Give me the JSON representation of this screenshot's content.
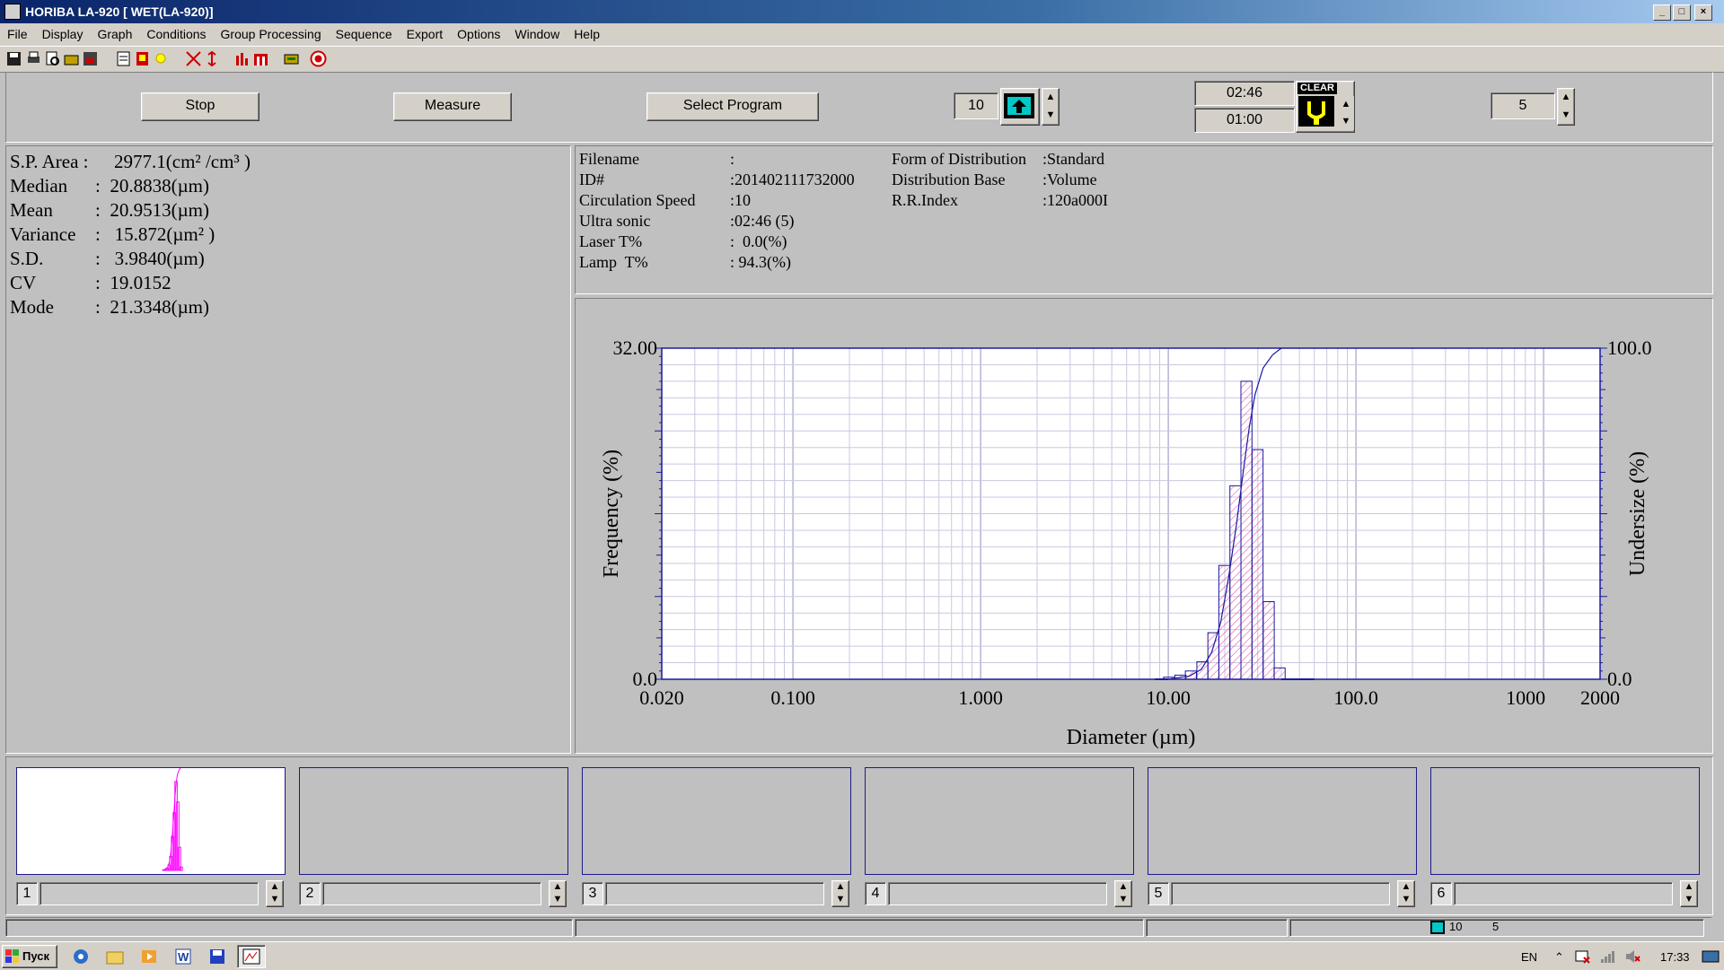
{
  "window": {
    "title": "HORIBA LA-920 [ WET(LA-920)]"
  },
  "menu": [
    "File",
    "Display",
    "Graph",
    "Conditions",
    "Group Processing",
    "Sequence",
    "Export",
    "Options",
    "Window",
    "Help"
  ],
  "controls": {
    "stop_label": "Stop",
    "measure_label": "Measure",
    "select_program_label": "Select Program",
    "circulation_value": "10",
    "time1": "02:46",
    "time2": "01:00",
    "clear_label": "CLEAR",
    "agitation_value": "5"
  },
  "stats": [
    {
      "label": "S.P. Area :",
      "value": "2977.1(cm² /cm³ )"
    },
    {
      "label": "Median",
      "value": ":  20.8838(µm)"
    },
    {
      "label": "Mean",
      "value": ":  20.9513(µm)"
    },
    {
      "label": "Variance",
      "value": ":   15.872(µm² )"
    },
    {
      "label": "S.D.",
      "value": ":   3.9840(µm)"
    },
    {
      "label": "CV",
      "value": ":  19.0152"
    },
    {
      "label": "Mode",
      "value": ":  21.3348(µm)"
    }
  ],
  "info_left": [
    {
      "label": "Filename",
      "value": ":"
    },
    {
      "label": "ID#",
      "value": ":201402111732000"
    },
    {
      "label": "Circulation Speed",
      "value": ":10"
    },
    {
      "label": "Ultra sonic",
      "value": ":02:46 (5)"
    },
    {
      "label": "Laser T%",
      "value": ":  0.0(%)"
    },
    {
      "label": "Lamp  T%",
      "value": ": 94.3(%)"
    }
  ],
  "info_right": [
    {
      "label": "Form of Distribution",
      "value": ":Standard"
    },
    {
      "label": "Distribution Base",
      "value": ":Volume"
    },
    {
      "label": "R.R.Index",
      "value": ":120a000I"
    }
  ],
  "chart_data": {
    "type": "bar",
    "xlabel": "Diameter (µm)",
    "ylabel": "Frequency (%)",
    "y2label": "Undersize (%)",
    "xscale": "log",
    "xlim": [
      0.02,
      2000
    ],
    "ylim": [
      0,
      32.0
    ],
    "y2lim": [
      0,
      100.0
    ],
    "ytick_labels": [
      "0.0",
      "32.00"
    ],
    "y2tick_labels": [
      "0.0",
      "100.0"
    ],
    "xtick_labels": [
      "0.020",
      "0.100",
      "1.000",
      "10.00",
      "100.0",
      "1000",
      "2000"
    ],
    "bars": [
      {
        "x": 10.1,
        "y": 0.2
      },
      {
        "x": 11.6,
        "y": 0.4
      },
      {
        "x": 13.2,
        "y": 0.8
      },
      {
        "x": 15.2,
        "y": 1.7
      },
      {
        "x": 17.4,
        "y": 4.5
      },
      {
        "x": 19.9,
        "y": 11.0
      },
      {
        "x": 22.8,
        "y": 18.7
      },
      {
        "x": 26.1,
        "y": 28.8
      },
      {
        "x": 29.9,
        "y": 22.2
      },
      {
        "x": 34.3,
        "y": 7.5
      },
      {
        "x": 39.2,
        "y": 1.1
      }
    ],
    "undersize": [
      {
        "x": 10.0,
        "y": 0
      },
      {
        "x": 13.0,
        "y": 1
      },
      {
        "x": 15.0,
        "y": 3
      },
      {
        "x": 17.0,
        "y": 8
      },
      {
        "x": 19.0,
        "y": 17
      },
      {
        "x": 21.0,
        "y": 31
      },
      {
        "x": 23.0,
        "y": 46
      },
      {
        "x": 25.0,
        "y": 62
      },
      {
        "x": 27.0,
        "y": 76
      },
      {
        "x": 29.0,
        "y": 86
      },
      {
        "x": 32.0,
        "y": 94
      },
      {
        "x": 36.0,
        "y": 98
      },
      {
        "x": 40.0,
        "y": 100
      }
    ]
  },
  "thumbnails": [
    {
      "index": "1",
      "has_plot": true
    },
    {
      "index": "2",
      "has_plot": false
    },
    {
      "index": "3",
      "has_plot": false
    },
    {
      "index": "4",
      "has_plot": false
    },
    {
      "index": "5",
      "has_plot": false
    },
    {
      "index": "6",
      "has_plot": false
    }
  ],
  "statusbar": {
    "circ": "10",
    "agit": "5"
  },
  "taskbar": {
    "start_label": "Пуск",
    "lang": "EN",
    "clock": "17:33"
  }
}
